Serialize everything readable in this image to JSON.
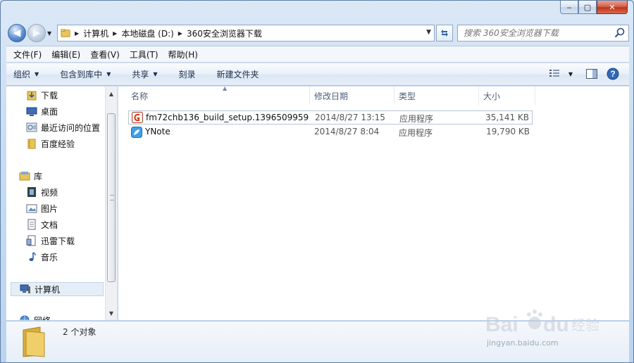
{
  "window": {
    "caption_minimize": "‒",
    "caption_maximize": "▢",
    "caption_close": "✕"
  },
  "address": {
    "crumbs": [
      "计算机",
      "本地磁盘 (D:)",
      "360安全浏览器下载"
    ],
    "search_placeholder": "搜索 360安全浏览器下载"
  },
  "menubar": {
    "items": [
      "文件(F)",
      "编辑(E)",
      "查看(V)",
      "工具(T)",
      "帮助(H)"
    ]
  },
  "commandbar": {
    "organize": "组织",
    "include_in_library": "包含到库中",
    "share": "共享",
    "burn": "刻录",
    "new_folder": "新建文件夹"
  },
  "navpane": {
    "favorites": [
      "下载",
      "桌面",
      "最近访问的位置",
      "百度经验"
    ],
    "libraries_label": "库",
    "libraries": [
      "视频",
      "图片",
      "文档",
      "迅雷下载",
      "音乐"
    ],
    "computer_label": "计算机",
    "network_label": "网络"
  },
  "filelist": {
    "columns": [
      "名称",
      "修改日期",
      "类型",
      "大小"
    ],
    "rows": [
      {
        "name": "fm72chb136_build_setup.1396509959",
        "date": "2014/8/27 13:15",
        "type": "应用程序",
        "size": "35,141 KB",
        "icon": "flashget-app-icon"
      },
      {
        "name": "YNote",
        "date": "2014/8/27 8:04",
        "type": "应用程序",
        "size": "19,790 KB",
        "icon": "ynote-app-icon"
      }
    ]
  },
  "details": {
    "count_text": "2 个对象"
  },
  "watermark": {
    "text": "jingyan.baidu.com"
  },
  "colors": {
    "accent": "#2c5ea6",
    "frame": "#c9dcf1"
  }
}
